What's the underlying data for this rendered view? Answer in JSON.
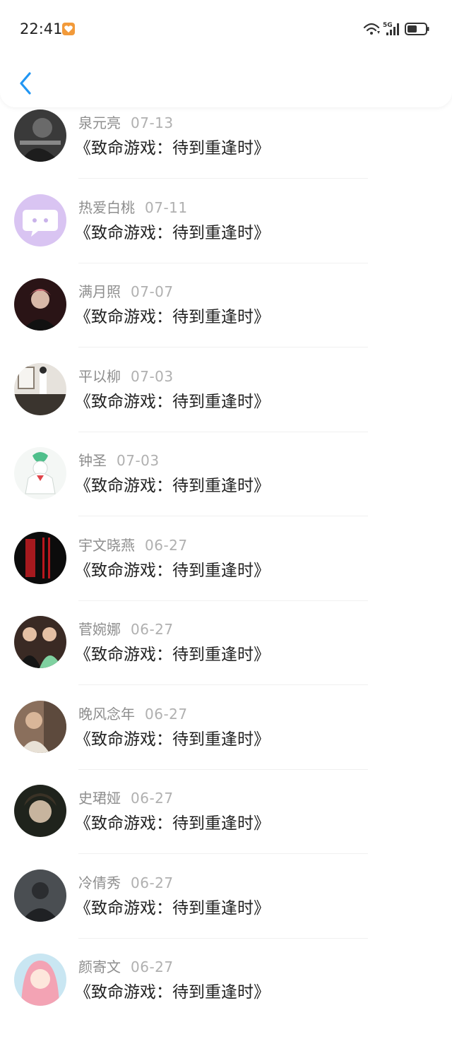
{
  "status_bar": {
    "time": "22:41",
    "network": "5G",
    "icons": [
      "heart-app-icon",
      "wifi-icon",
      "signal-icon",
      "battery-icon"
    ]
  },
  "nav": {
    "back_icon": "chevron-left-icon",
    "accent_color": "#2196f3"
  },
  "items": [
    {
      "name": "泉元亮",
      "date": "07-13",
      "title": "《致命游戏：待到重逢时》"
    },
    {
      "name": "热爱白桃",
      "date": "07-11",
      "title": "《致命游戏：待到重逢时》"
    },
    {
      "name": "满月照",
      "date": "07-07",
      "title": "《致命游戏：待到重逢时》"
    },
    {
      "name": "平以柳",
      "date": "07-03",
      "title": "《致命游戏：待到重逢时》"
    },
    {
      "name": "钟圣",
      "date": "07-03",
      "title": "《致命游戏：待到重逢时》"
    },
    {
      "name": "宇文晓燕",
      "date": "06-27",
      "title": "《致命游戏：待到重逢时》"
    },
    {
      "name": "菅婉娜",
      "date": "06-27",
      "title": "《致命游戏：待到重逢时》"
    },
    {
      "name": "晚风念年",
      "date": "06-27",
      "title": "《致命游戏：待到重逢时》"
    },
    {
      "name": "史珺娅",
      "date": "06-27",
      "title": "《致命游戏：待到重逢时》"
    },
    {
      "name": "冷倩秀",
      "date": "06-27",
      "title": "《致命游戏：待到重逢时》"
    },
    {
      "name": "颜寄文",
      "date": "06-27",
      "title": "《致命游戏：待到重逢时》"
    }
  ]
}
